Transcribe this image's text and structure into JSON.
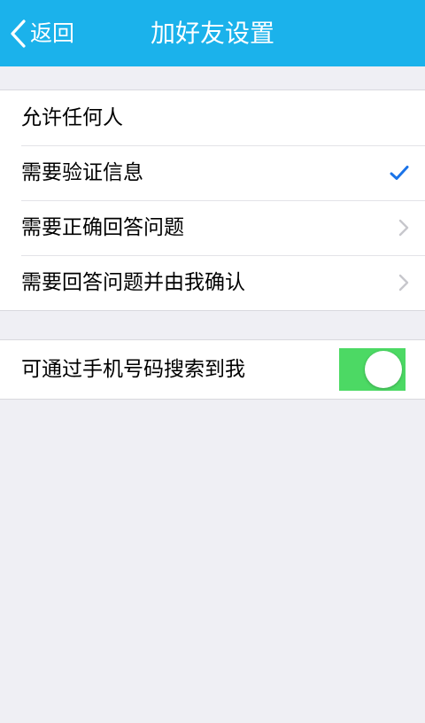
{
  "navbar": {
    "back_label": "返回",
    "title": "加好友设置",
    "background": "#1bb2eb"
  },
  "verification_options": {
    "items": [
      {
        "label": "允许任何人",
        "accessory": "none"
      },
      {
        "label": "需要验证信息",
        "accessory": "checkmark-icon",
        "selected": true
      },
      {
        "label": "需要正确回答问题",
        "accessory": "chevron-right-icon"
      },
      {
        "label": "需要回答问题并由我确认",
        "accessory": "chevron-right-icon"
      }
    ],
    "check_color": "#1a73e8"
  },
  "phone_search": {
    "label": "可通过手机号码搜索到我",
    "enabled": true,
    "toggle_color": "#4cd964"
  }
}
